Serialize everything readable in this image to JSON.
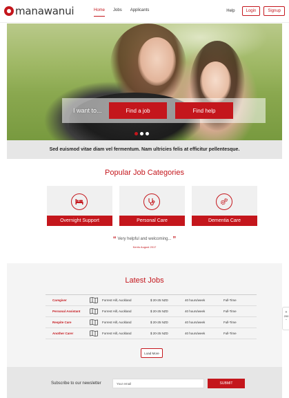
{
  "header": {
    "logo_text": "manawanui",
    "nav": [
      "Home",
      "Jobs",
      "Applicants"
    ],
    "help": "Help",
    "login": "Login",
    "signup": "Signup"
  },
  "hero": {
    "want_label": "I want to...",
    "find_job": "Find a job",
    "find_help": "Find help",
    "slides": 3,
    "active_slide": 1
  },
  "tagline": "Sed euismod vitae diam vel fermentum. Nam ultricies felis at efficitur pellentesque.",
  "categories": {
    "title": "Popular Job Categories",
    "items": [
      {
        "label": "Overnight Support",
        "icon": "bed-icon"
      },
      {
        "label": "Personal Care",
        "icon": "stethoscope-icon"
      },
      {
        "label": "Dementia Care",
        "icon": "gears-icon"
      }
    ]
  },
  "testimonial": {
    "quote": "Very helpful and welcoming...",
    "author": "Kerris August 2017"
  },
  "jobs": {
    "title": "Latest Jobs",
    "rows": [
      {
        "title": "Caregiver",
        "location": "Forrest Hill, Auckland",
        "pay": "$ 20-25 NZD",
        "hours": "40 hours/week",
        "type": "Full-Time"
      },
      {
        "title": "Personal Assistant",
        "location": "Forrest Hill, Auckland",
        "pay": "$ 20-25 NZD",
        "hours": "40 hours/week",
        "type": "Full-Time"
      },
      {
        "title": "Respite Care",
        "location": "Forrest Hill, Auckland",
        "pay": "$ 20-25 NZD",
        "hours": "40 hours/week",
        "type": "Full-Time"
      },
      {
        "title": "Another Carer",
        "location": "Forrest Hill, Auckland",
        "pay": "$ 20-25 NZD",
        "hours": "40 hours/week",
        "type": "Full-Time"
      }
    ],
    "load_more": "Load More"
  },
  "zoom": {
    "plus": "+",
    "level": "200",
    "minus": "-"
  },
  "newsletter": {
    "label": "Subscribe to our newsletter",
    "placeholder": "Your email",
    "button": "SUBMIT"
  },
  "colors": {
    "accent": "#c4161c"
  }
}
